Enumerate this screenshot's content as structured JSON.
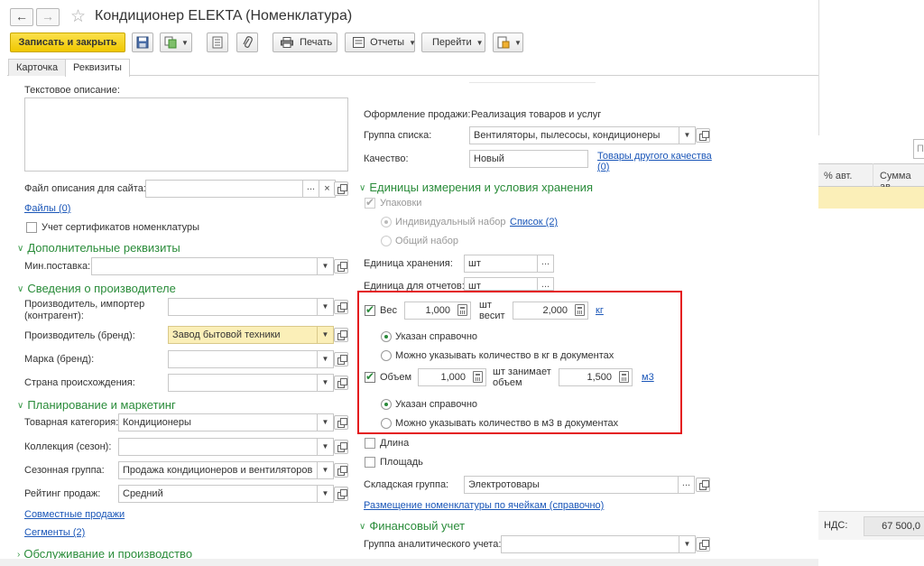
{
  "window": {
    "title": "Кондиционер ELEKTA (Номенклатура)"
  },
  "toolbar": {
    "save_close": "Записать и закрыть",
    "print": "Печать",
    "reports": "Отчеты",
    "goto": "Перейти"
  },
  "tabs": [
    {
      "label": "Карточка",
      "active": false
    },
    {
      "label": "Реквизиты",
      "active": true
    }
  ],
  "left": {
    "text_desc_label": "Текстовое описание:",
    "site_file_label": "Файл описания для сайта:",
    "site_file_value": "",
    "files_link": "Файлы (0)",
    "cert_label": "Учет сертификатов номенклатуры",
    "section_additional": "Дополнительные реквизиты",
    "min_supply_label": "Мин.поставка:",
    "min_supply_value": "",
    "section_manufacturer": "Сведения о производителе",
    "importer_label": "Производитель, импортер (контрагент):",
    "importer_value": "",
    "brand_maker_label": "Производитель (бренд):",
    "brand_maker_value": "Завод бытовой техники",
    "brand_label": "Марка (бренд):",
    "brand_value": "",
    "country_label": "Страна происхождения:",
    "country_value": "",
    "section_planning": "Планирование и маркетинг",
    "category_label": "Товарная категория:",
    "category_value": "Кондиционеры",
    "collection_label": "Коллекция (сезон):",
    "collection_value": "",
    "season_label": "Сезонная группа:",
    "season_value": "Продажа кондиционеров и вентиляторов",
    "rating_label": "Рейтинг продаж:",
    "rating_value": "Средний",
    "joint_sales_link": "Совместные продажи",
    "segments_link": "Сегменты (2)",
    "section_service": "Обслуживание и производство"
  },
  "right": {
    "sale_design_label": "Оформление продажи:",
    "sale_design_value": "Реализация товаров и услуг",
    "list_group_label": "Группа списка:",
    "list_group_value": "Вентиляторы, пылесосы, кондиционеры",
    "quality_label": "Качество:",
    "quality_value": "Новый",
    "other_quality_link": "Товары другого качества (0)",
    "section_units": "Единицы измерения и условия хранения",
    "packages_label": "Упаковки",
    "individual_set": "Индивидуальный набор",
    "list_link": "Список (2)",
    "common_set": "Общий набор",
    "storage_unit_label": "Единица хранения:",
    "storage_unit_value": "шт",
    "report_unit_label": "Единица для отчетов:",
    "report_unit_value": "шт",
    "weight_label": "Вес",
    "weight_qty": "1,000",
    "weight_mid": "шт весит",
    "weight_value": "2,000",
    "weight_unit": "кг",
    "weight_radio1": "Указан справочно",
    "weight_radio2": "Можно указывать количество в кг в документах",
    "volume_label": "Объем",
    "volume_qty": "1,000",
    "volume_mid": "шт занимает объем",
    "volume_value": "1,500",
    "volume_unit": "м3",
    "volume_radio1": "Указан справочно",
    "volume_radio2": "Можно указывать количество в м3 в документах",
    "length_label": "Длина",
    "area_label": "Площадь",
    "warehouse_group_label": "Складская группа:",
    "warehouse_group_value": "Электротовары",
    "placement_link": "Размещение номенклатуры по ячейкам (справочно)",
    "section_finance": "Финансовый учет",
    "analytics_group_label": "Группа аналитического учета:",
    "analytics_group_value": ""
  },
  "background_window": {
    "search_placeholder": "По",
    "col_percent": "% авт.",
    "col_sum": "Сумма ав",
    "nds_label": "НДС:",
    "nds_value": "67 500,0"
  },
  "colors": {
    "accent_green": "#2a8c3a",
    "link_blue": "#1a56b8",
    "primary_yellow": "#f0c800",
    "highlight_red": "#e4161b",
    "field_yellow": "#fbefb8"
  }
}
